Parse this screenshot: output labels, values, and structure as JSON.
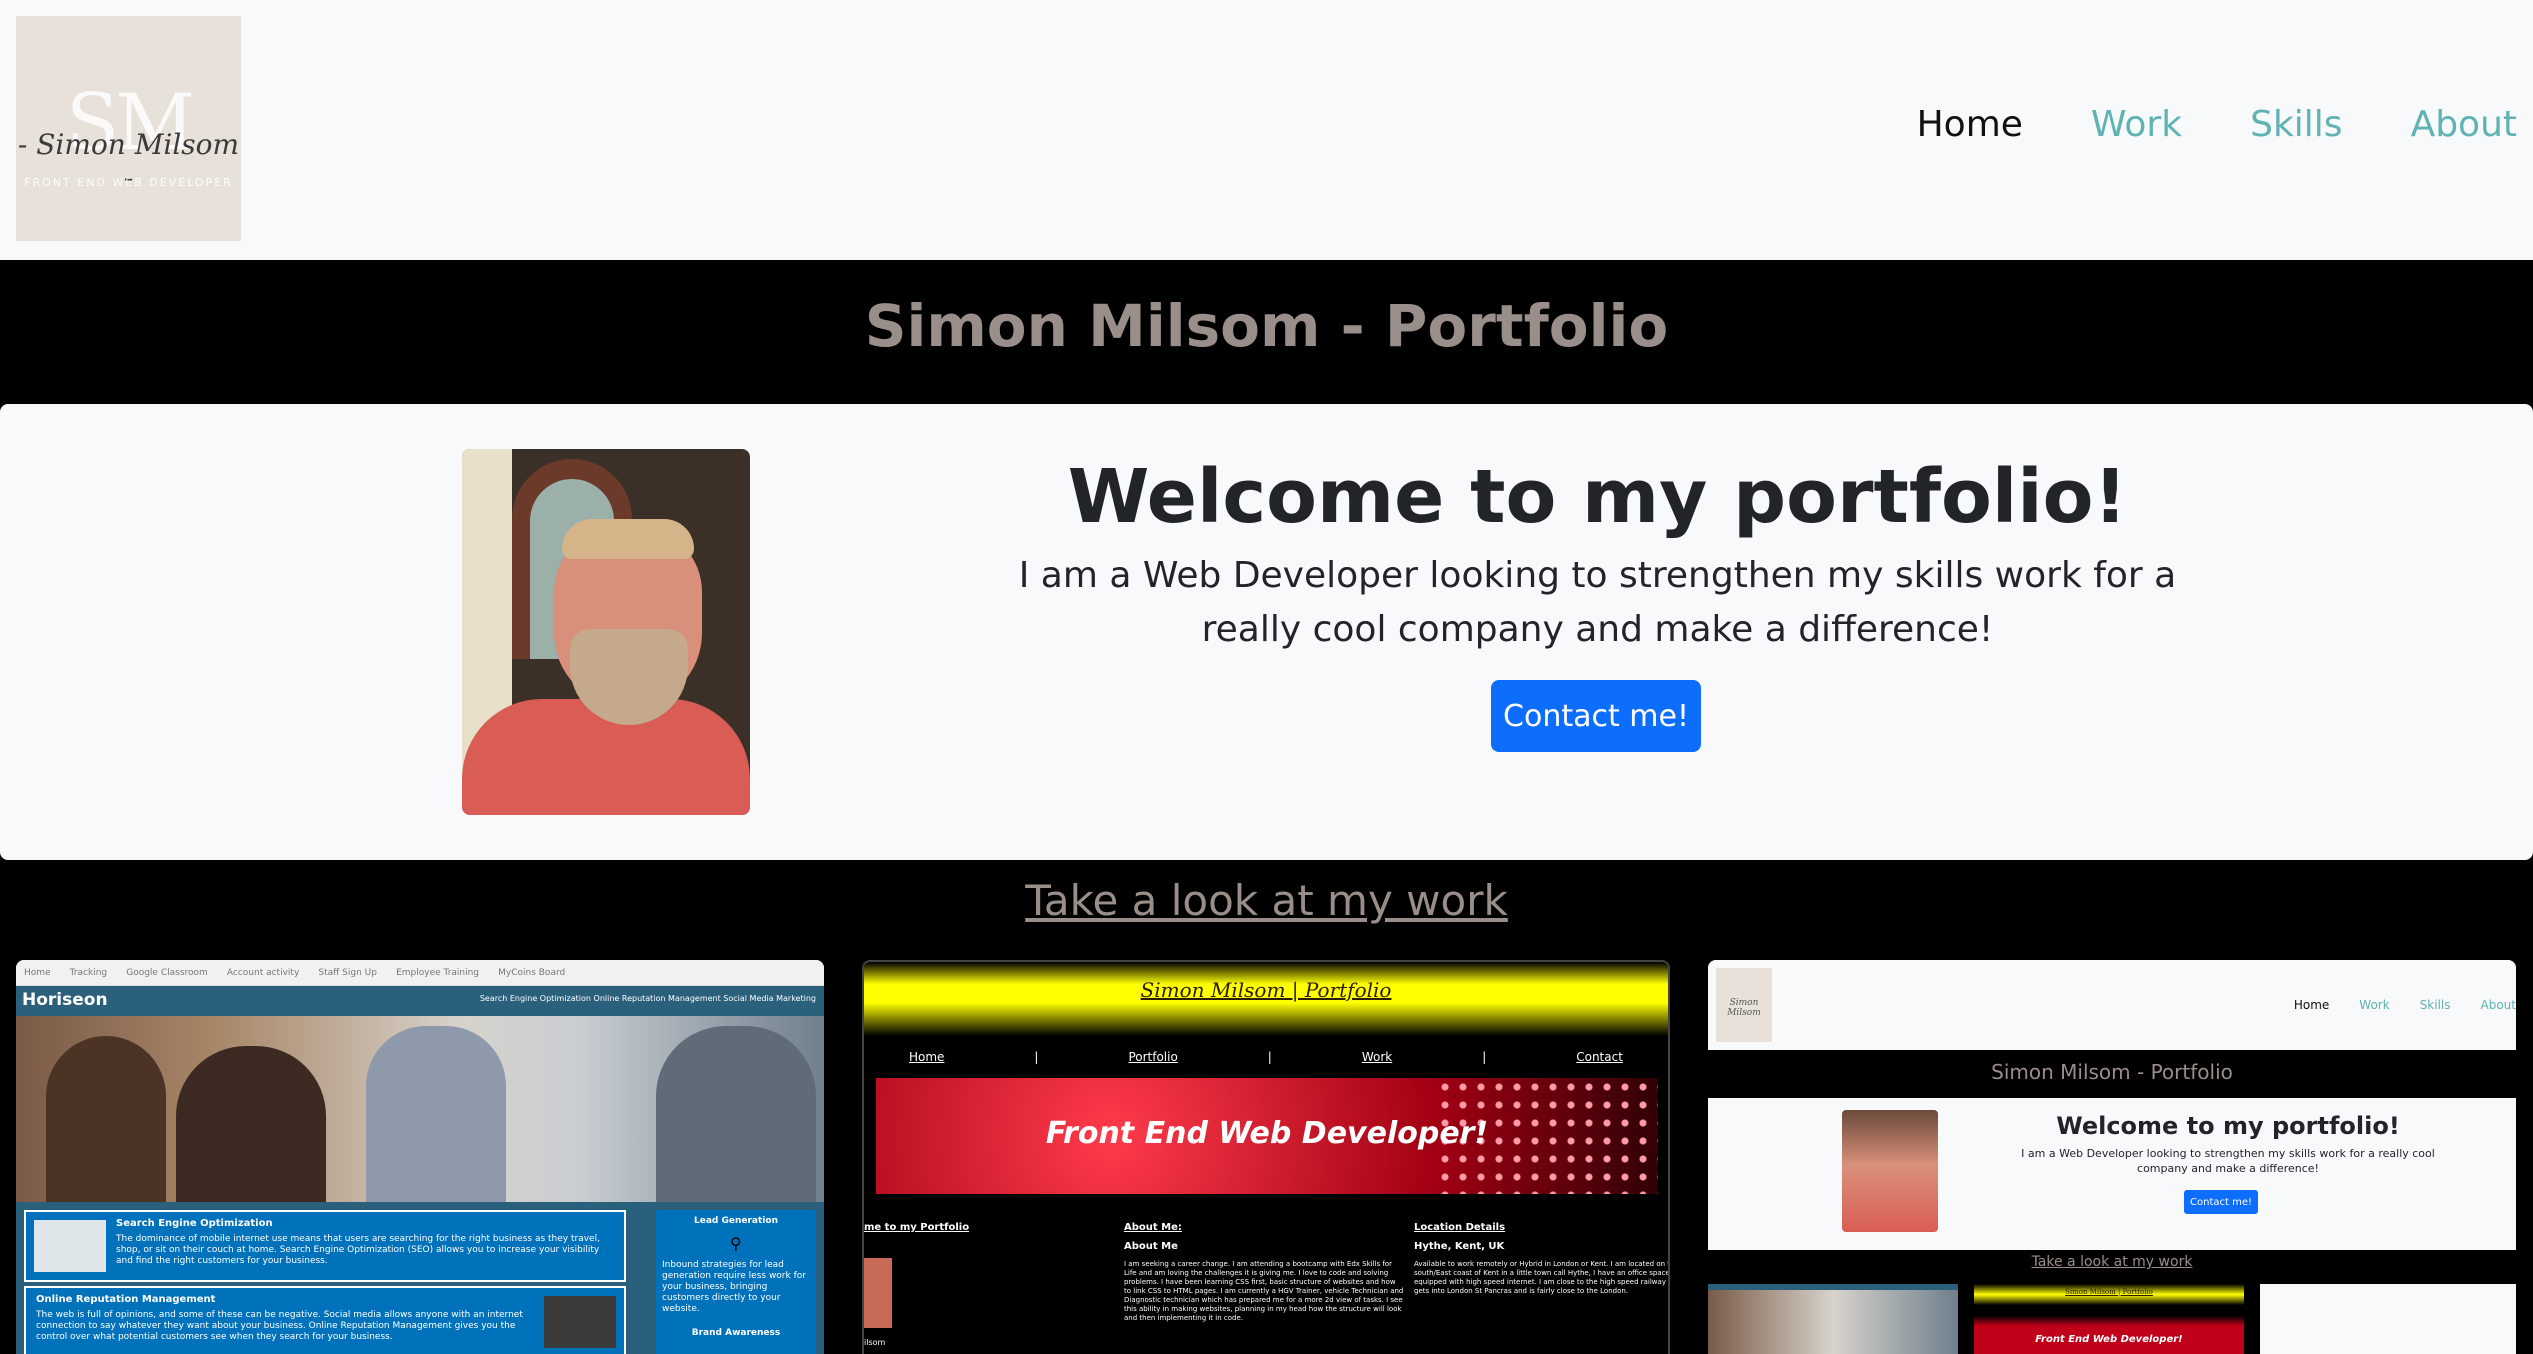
{
  "logo": {
    "monogram": "SM",
    "script": "- Simon Milsom -",
    "tagline": "FRONT END WEB DEVELOPER"
  },
  "nav": {
    "items": [
      {
        "label": "Home",
        "active": true
      },
      {
        "label": "Work",
        "active": false
      },
      {
        "label": "Skills",
        "active": false
      },
      {
        "label": "About",
        "active": false
      }
    ]
  },
  "site_title": "Simon Milsom - Portfolio",
  "hero": {
    "heading": "Welcome to my portfolio!",
    "text": "I am a Web Developer looking to strengthen my skills work for a really cool company and make a difference!",
    "button": "Contact me!"
  },
  "work_heading": "Take a look at my work",
  "colors": {
    "nav_link": "#5fb3b3",
    "button": "#0d6efd",
    "title_text": "#9a8e8a"
  },
  "card1": {
    "browser_tabs": [
      "Home",
      "Tracking",
      "Google Classroom",
      "Account activity",
      "Staff Sign Up",
      "Employee Training",
      "MyCoins Board"
    ],
    "logo": "Horiseon",
    "menu": "Search Engine Optimization   Online Reputation Management   Social Media Marketing",
    "box1_title": "Search Engine Optimization",
    "box1_text": "The dominance of mobile internet use means that users are searching for the right business as they travel, shop, or sit on their couch at home. Search Engine Optimization (SEO) allows you to increase your visibility and find the right customers for your business.",
    "box2_title": "Online Reputation Management",
    "box2_text": "The web is full of opinions, and some of these can be negative. Social media allows anyone with an internet connection to say whatever they want about your business. Online Reputation Management gives you the control over what potential customers see when they search for your business.",
    "side_title": "Lead Generation",
    "side_text": "Inbound strategies for lead generation require less work for your business, bringing customers directly to your website.",
    "side_title2": "Brand Awareness"
  },
  "card2": {
    "title": "Simon Milsom | Portfolio",
    "nav": [
      "Home",
      "|",
      "Portfolio",
      "|",
      "Work",
      "|",
      "Contact"
    ],
    "banner": "Front End Web Developer!",
    "col1_heading": "me to my Portfolio",
    "col2_heading": "About Me:",
    "col2_sub": "About Me",
    "col2_text": "I am seeking a career change. I am attending a bootcamp with Edx Skills for Life and am loving the challenges it is giving me. I love to code and solving problems. I have been learning CSS first, basic structure of websites and how to link CSS to HTML pages. I am currently a HGV Trainer, vehicle Technician and Diagnostic technician which has prepared me for a more 2d view of tasks. I see this ability in making websites, planning in my head how the structure will look and then implementing it in code.",
    "col3_heading": "Location Details",
    "col3_sub": "Hythe, Kent, UK",
    "col3_text": "Available to work remotely or Hybrid in London or Kent. I am located on the south/East coast of Kent in a little town call Hythe, I have an office space equipped with high speed internet. I am close to the high speed railway which gets into London St Pancras and is fairly close to the London.",
    "footer": "ilsom"
  },
  "card3": {
    "logo": "Simon Milsom",
    "nav": [
      {
        "label": "Home",
        "active": true
      },
      {
        "label": "Work",
        "active": false
      },
      {
        "label": "Skills",
        "active": false
      },
      {
        "label": "About",
        "active": false
      }
    ],
    "title": "Simon Milsom - Portfolio",
    "heading": "Welcome to my portfolio!",
    "text": "I am a Web Developer looking to strengthen my skills work for a really cool company and make a difference!",
    "button": "Contact me!",
    "work_heading": "Take a look at my work",
    "mini_title": "Simon Milsom | Portfolio",
    "mini_banner": "Front End Web Developer!"
  }
}
